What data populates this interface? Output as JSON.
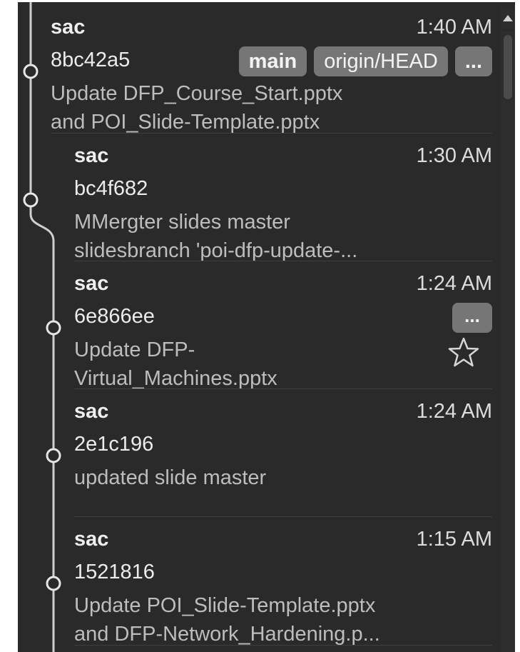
{
  "colors": {
    "panel_background": "#2a2a2a",
    "badge_background": "#767676",
    "graph_line": "#cfcfcf"
  },
  "commits": [
    {
      "author": "sac",
      "time": "1:40 AM",
      "hash": "8bc42a5",
      "message_lines": [
        "Update DFP_Course_Start.pptx",
        "and POI_Slide-Template.pptx"
      ],
      "badges": [
        "main",
        "origin/HEAD",
        "..."
      ]
    },
    {
      "author": "sac",
      "time": "1:30 AM",
      "hash": "bc4f682",
      "message_lines": [
        "MMergter slides master",
        "slidesbranch 'poi-dfp-update-..."
      ]
    },
    {
      "author": "sac",
      "time": "1:24 AM",
      "hash": "6e866ee",
      "message_lines": [
        "Update DFP-",
        "Virtual_Machines.pptx"
      ],
      "more_label": "...",
      "star_icon": "star-outline-icon"
    },
    {
      "author": "sac",
      "time": "1:24 AM",
      "hash": "2e1c196",
      "message_lines": [
        "updated slide master"
      ]
    },
    {
      "author": "sac",
      "time": "1:15 AM",
      "hash": "1521816",
      "message_lines": [
        "Update POI_Slide-Template.pptx",
        "and DFP-Network_Hardening.p..."
      ]
    }
  ]
}
